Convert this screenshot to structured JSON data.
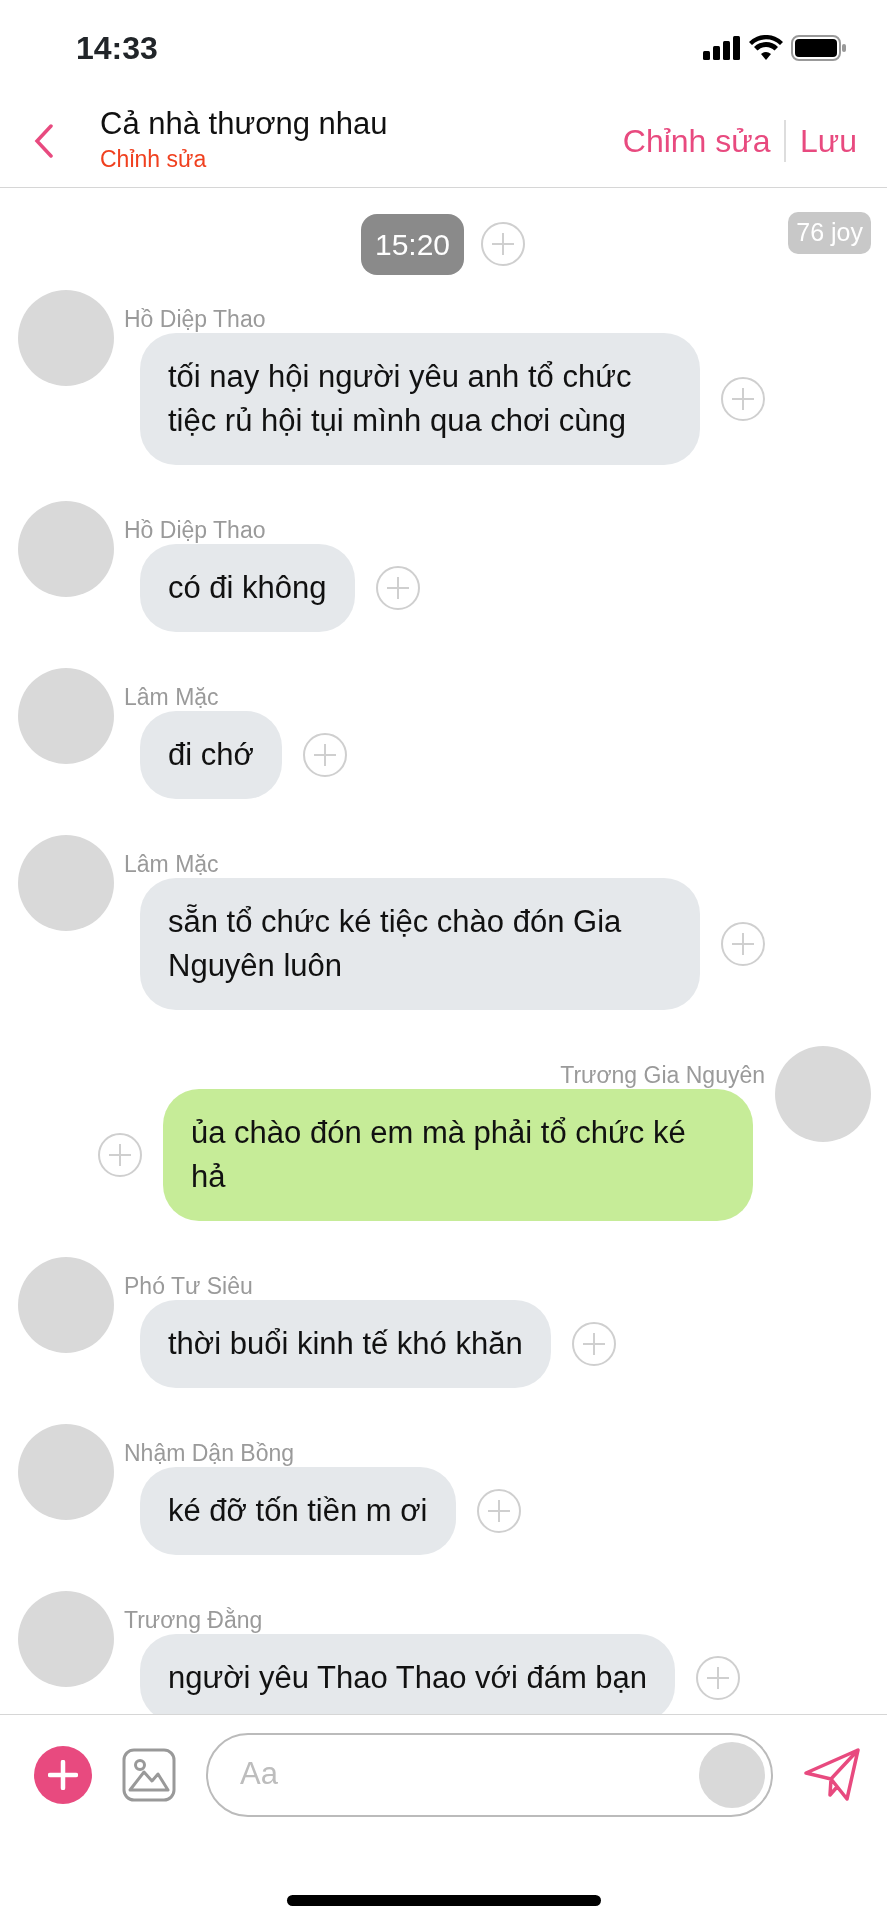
{
  "status_bar": {
    "time": "14:33"
  },
  "header": {
    "title": "Cả nhà thương nhau",
    "subtitle": "Chỉnh sửa",
    "actions": [
      "Chỉnh sửa",
      "Lưu"
    ]
  },
  "timestamp": "15:20",
  "joy_badge": "76 joy",
  "messages": [
    {
      "sender": "Hồ Diệp Thao",
      "text": "tối nay hội người yêu anh tổ chức tiệc rủ hội tụi mình qua chơi cùng",
      "outgoing": false
    },
    {
      "sender": "Hồ Diệp Thao",
      "text": "có đi không",
      "outgoing": false
    },
    {
      "sender": "Lâm Mặc",
      "text": "đi chớ",
      "outgoing": false
    },
    {
      "sender": "Lâm Mặc",
      "text": "sẵn tổ chức ké tiệc chào đón Gia Nguyên luôn",
      "outgoing": false
    },
    {
      "sender": "Trương Gia Nguyên",
      "text": "ủa chào đón em mà phải tổ chức ké hả",
      "outgoing": true
    },
    {
      "sender": "Phó Tư Siêu",
      "text": "thời buổi kinh tế khó khăn",
      "outgoing": false
    },
    {
      "sender": "Nhậm Dận Bồng",
      "text": "ké đỡ tốn tiền m ơi",
      "outgoing": false
    },
    {
      "sender": "Trương Đằng",
      "text": "người yêu Thao Thao với đám bạn",
      "outgoing": false
    }
  ],
  "composer": {
    "placeholder": "Aa"
  }
}
